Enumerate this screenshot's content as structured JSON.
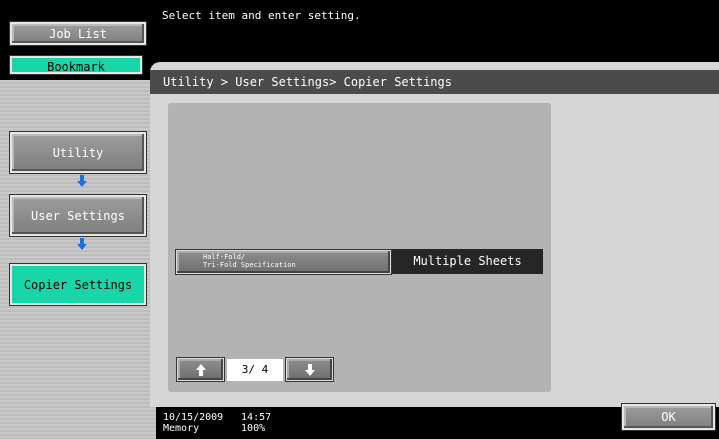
{
  "sidebar": {
    "job_list_label": "Job List",
    "bookmark_label": "Bookmark",
    "steps": [
      {
        "label": "Utility"
      },
      {
        "label": "User Settings"
      },
      {
        "label": "Copier Settings"
      }
    ]
  },
  "message": "Select item and enter setting.",
  "breadcrumb": "Utility > User Settings> Copier Settings",
  "setting": {
    "label_line1": "Half-Fold/",
    "label_line2": "Tri-Fold Specification",
    "value": "Multiple Sheets"
  },
  "pagination": {
    "up_icon": "arrow-up",
    "down_icon": "arrow-down",
    "page_indicator": "3/ 4"
  },
  "status": {
    "date": "10/15/2009",
    "time": "14:57",
    "memory_label": "Memory",
    "memory_value": "100%"
  },
  "ok_label": "OK",
  "colors": {
    "active_step": "#18d6a7",
    "arrow": "#1e6fd9"
  }
}
